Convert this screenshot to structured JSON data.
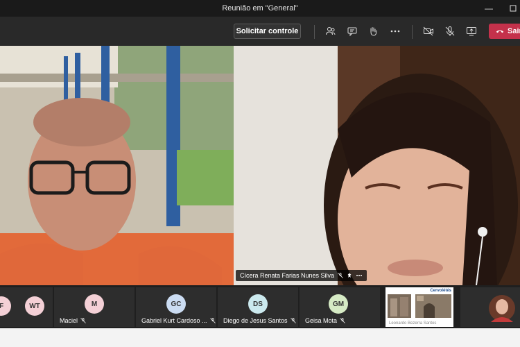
{
  "window": {
    "title": "Reunião em \"General\""
  },
  "toolbar": {
    "request_control": "Solicitar controle",
    "leave_label": "Sair",
    "icons": [
      "participants-icon",
      "chat-icon",
      "raise-hand-icon",
      "more-icon",
      "camera-off-icon",
      "mic-off-icon",
      "share-screen-icon",
      "phone-hangup-icon"
    ]
  },
  "stage": {
    "left_name": "",
    "right_name": "Cícera Renata Farias Nunes Silva"
  },
  "roster": [
    {
      "initials": "F",
      "name": "",
      "color": "#f4d0d6"
    },
    {
      "initials": "WT",
      "name": "",
      "color": "#f4d0d6"
    },
    {
      "initials": "M",
      "name": "Maciel",
      "color": "#f4d0d6"
    },
    {
      "initials": "GC",
      "name": "Gabriel Kurt Cardoso ...",
      "color": "#cbdcf2"
    },
    {
      "initials": "DS",
      "name": "Diego de Jesus Santos",
      "color": "#cbe9ee"
    },
    {
      "initials": "GM",
      "name": "Geisa Mota",
      "color": "#d6ebc5"
    }
  ],
  "shared": {
    "logo_text": "Cervolétés",
    "caption": "Leonardo Bezerra Santos"
  },
  "colors": {
    "leave": "#c4314b",
    "toolbar": "#292929",
    "titlebar": "#1a1a1a"
  }
}
